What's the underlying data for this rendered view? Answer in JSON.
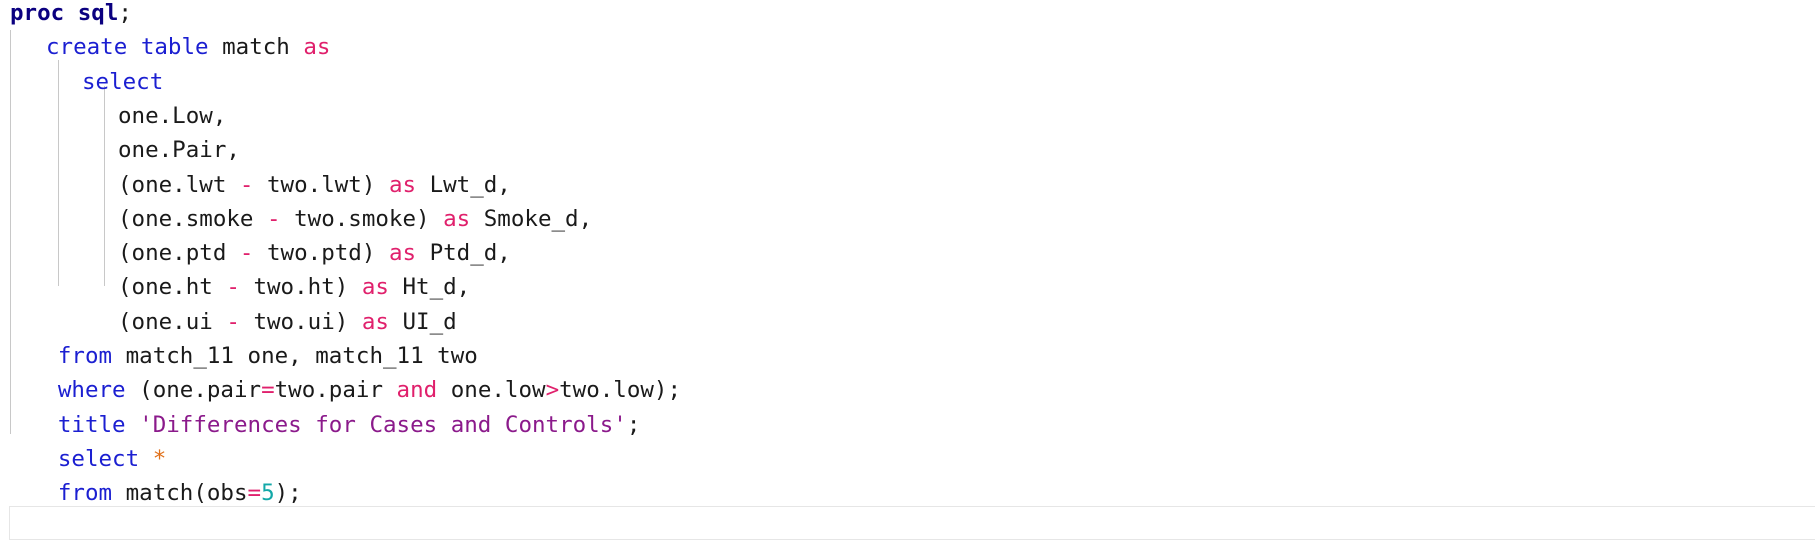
{
  "lines": [
    {
      "indent": 0,
      "tokens": [
        {
          "t": "proc sql",
          "c": "kw-bold"
        },
        {
          "t": ";",
          "c": "plain"
        }
      ]
    },
    {
      "indent": 1,
      "tokens": [
        {
          "t": "create table",
          "c": "kw"
        },
        {
          "t": " match ",
          "c": "plain"
        },
        {
          "t": "as",
          "c": "op"
        }
      ]
    },
    {
      "indent": 2,
      "tokens": [
        {
          "t": "select",
          "c": "kw"
        }
      ]
    },
    {
      "indent": 3,
      "tokens": [
        {
          "t": "one.Low,",
          "c": "plain"
        }
      ]
    },
    {
      "indent": 3,
      "tokens": [
        {
          "t": "one.Pair,",
          "c": "plain"
        }
      ]
    },
    {
      "indent": 3,
      "tokens": [
        {
          "t": "(one.lwt ",
          "c": "plain"
        },
        {
          "t": "-",
          "c": "op"
        },
        {
          "t": " two.lwt) ",
          "c": "plain"
        },
        {
          "t": "as",
          "c": "op"
        },
        {
          "t": " Lwt_d,",
          "c": "plain"
        }
      ]
    },
    {
      "indent": 3,
      "tokens": [
        {
          "t": "(one.smoke ",
          "c": "plain"
        },
        {
          "t": "-",
          "c": "op"
        },
        {
          "t": " two.smoke) ",
          "c": "plain"
        },
        {
          "t": "as",
          "c": "op"
        },
        {
          "t": " Smoke_d,",
          "c": "plain"
        }
      ]
    },
    {
      "indent": 3,
      "tokens": [
        {
          "t": "(one.ptd ",
          "c": "plain"
        },
        {
          "t": "-",
          "c": "op"
        },
        {
          "t": " two.ptd) ",
          "c": "plain"
        },
        {
          "t": "as",
          "c": "op"
        },
        {
          "t": " Ptd_d,",
          "c": "plain"
        }
      ]
    },
    {
      "indent": 3,
      "tokens": [
        {
          "t": "(one.ht ",
          "c": "plain"
        },
        {
          "t": "-",
          "c": "op"
        },
        {
          "t": " two.ht) ",
          "c": "plain"
        },
        {
          "t": "as",
          "c": "op"
        },
        {
          "t": " Ht_d,",
          "c": "plain"
        }
      ]
    },
    {
      "indent": 3,
      "tokens": [
        {
          "t": "(one.ui ",
          "c": "plain"
        },
        {
          "t": "-",
          "c": "op"
        },
        {
          "t": " two.ui) ",
          "c": "plain"
        },
        {
          "t": "as",
          "c": "op"
        },
        {
          "t": " UI_d",
          "c": "plain"
        }
      ]
    },
    {
      "indent": 1.33,
      "tokens": [
        {
          "t": "from",
          "c": "kw"
        },
        {
          "t": " match_11 one, match_11 two",
          "c": "plain"
        }
      ]
    },
    {
      "indent": 1.33,
      "tokens": [
        {
          "t": "where",
          "c": "kw"
        },
        {
          "t": " (one.pair",
          "c": "plain"
        },
        {
          "t": "=",
          "c": "op"
        },
        {
          "t": "two.pair ",
          "c": "plain"
        },
        {
          "t": "and",
          "c": "op"
        },
        {
          "t": " one.low",
          "c": "plain"
        },
        {
          "t": ">",
          "c": "op"
        },
        {
          "t": "two.low);",
          "c": "plain"
        }
      ]
    },
    {
      "indent": 1.33,
      "tokens": [
        {
          "t": "title",
          "c": "kw"
        },
        {
          "t": " ",
          "c": "plain"
        },
        {
          "t": "'Differences for Cases and Controls'",
          "c": "str"
        },
        {
          "t": ";",
          "c": "plain"
        }
      ]
    },
    {
      "indent": 1.33,
      "tokens": [
        {
          "t": "select",
          "c": "kw"
        },
        {
          "t": " ",
          "c": "plain"
        },
        {
          "t": "*",
          "c": "star"
        }
      ]
    },
    {
      "indent": 1.33,
      "tokens": [
        {
          "t": "from",
          "c": "kw"
        },
        {
          "t": " match(obs",
          "c": "plain"
        },
        {
          "t": "=",
          "c": "op"
        },
        {
          "t": "5",
          "c": "num"
        },
        {
          "t": ");",
          "c": "plain"
        }
      ]
    }
  ]
}
